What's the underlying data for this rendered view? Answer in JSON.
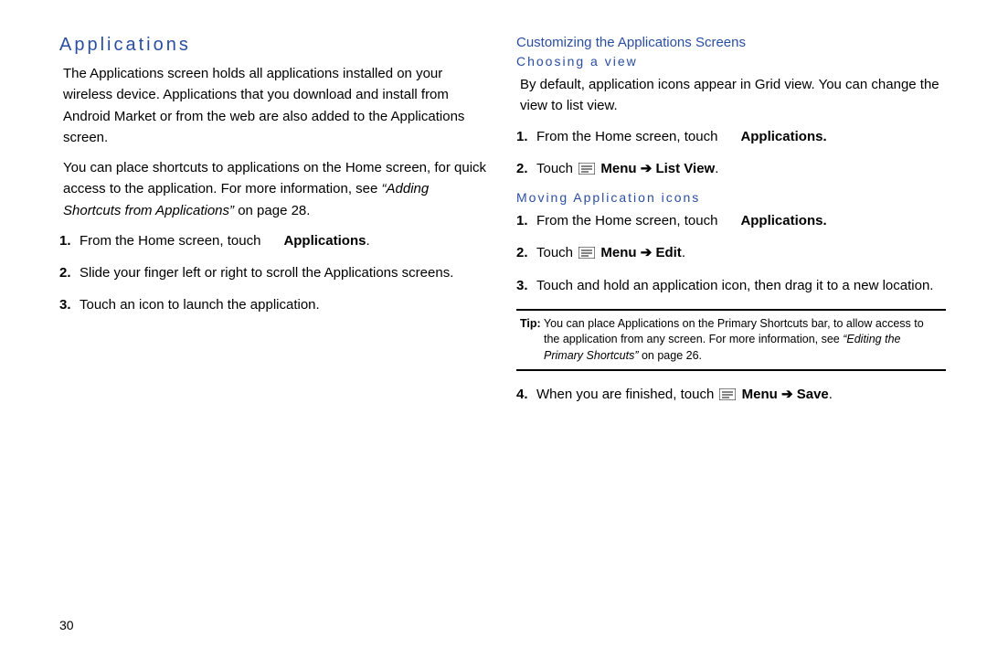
{
  "page_number": "30",
  "left": {
    "heading": "Applications",
    "para1": "The Applications screen holds all applications installed on your wireless device. Applications that you download and install from Android Market or from the web are also added to the Applications screen.",
    "para2_a": "You can place shortcuts to applications on the Home screen, for quick access to the application. For more information, see ",
    "para2_b": "“Adding Shortcuts from Applications”",
    "para2_c": " on page 28.",
    "step1_a": "From the Home screen, touch ",
    "step1_b": "Applications",
    "step1_c": ".",
    "step2": "Slide your finger left or right to scroll the Applications screens.",
    "step3": "Touch an icon to launch the application."
  },
  "right": {
    "heading": "Customizing the Applications Screens",
    "sub1": "Choosing a view",
    "para1": "By default, application icons appear in Grid view. You can change the view to list view.",
    "s1step1_a": "From the Home screen, touch ",
    "s1step1_b": "Applications.",
    "s1step2_a": "Touch ",
    "s1step2_menu": "Menu",
    "s1step2_b": "List View",
    "s1step2_c": ".",
    "sub2": "Moving Application icons",
    "s2step1_a": "From the Home screen, touch ",
    "s2step1_b": "Applications.",
    "s2step2_a": "Touch ",
    "s2step2_menu": "Menu",
    "s2step2_b": "Edit",
    "s2step2_c": ".",
    "s2step3": "Touch and hold an application icon, then drag it to a new location.",
    "tip_label": "Tip:",
    "tip_a": " You can place Applications on the Primary Shortcuts bar, to allow access to the application from any screen. For more information, see ",
    "tip_b": "“Editing the Primary Shortcuts”",
    "tip_c": " on page 26.",
    "s2step4_a": "When you are finished, touch ",
    "s2step4_menu": "Menu",
    "s2step4_b": "Save",
    "s2step4_c": "."
  }
}
